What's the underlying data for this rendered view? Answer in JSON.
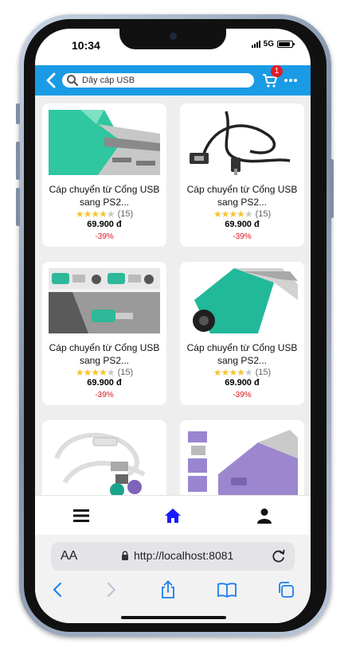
{
  "status_bar": {
    "time": "10:34",
    "network": "5G"
  },
  "header": {
    "search_value": "Dây cáp USB",
    "cart_count": "1",
    "accent_color": "#1a9be6"
  },
  "products": [
    {
      "name": "Cáp chuyển từ Cổng USB sang PS2...",
      "rating": 4,
      "reviews": "(15)",
      "price": "69.900 đ",
      "discount": "-39%"
    },
    {
      "name": "Cáp chuyển từ Cổng USB sang PS2...",
      "rating": 4,
      "reviews": "(15)",
      "price": "69.900 đ",
      "discount": "-39%"
    },
    {
      "name": "Cáp chuyển từ Cổng USB sang PS2...",
      "rating": 4,
      "reviews": "(15)",
      "price": "69.900 đ",
      "discount": "-39%"
    },
    {
      "name": "Cáp chuyển từ Cổng USB sang PS2...",
      "rating": 4,
      "reviews": "(15)",
      "price": "69.900 đ",
      "discount": "-39%"
    },
    {
      "name": "",
      "rating": 0,
      "reviews": "",
      "price": "",
      "discount": ""
    },
    {
      "name": "",
      "rating": 0,
      "reviews": "",
      "price": "",
      "discount": ""
    }
  ],
  "bottom_nav": {
    "items": [
      {
        "icon": "menu-icon",
        "active": false
      },
      {
        "icon": "home-icon",
        "active": true
      },
      {
        "icon": "user-icon",
        "active": false
      }
    ],
    "active_color": "#1a1aff"
  },
  "browser": {
    "text_size_label": "AA",
    "url": "http://localhost:8081"
  }
}
